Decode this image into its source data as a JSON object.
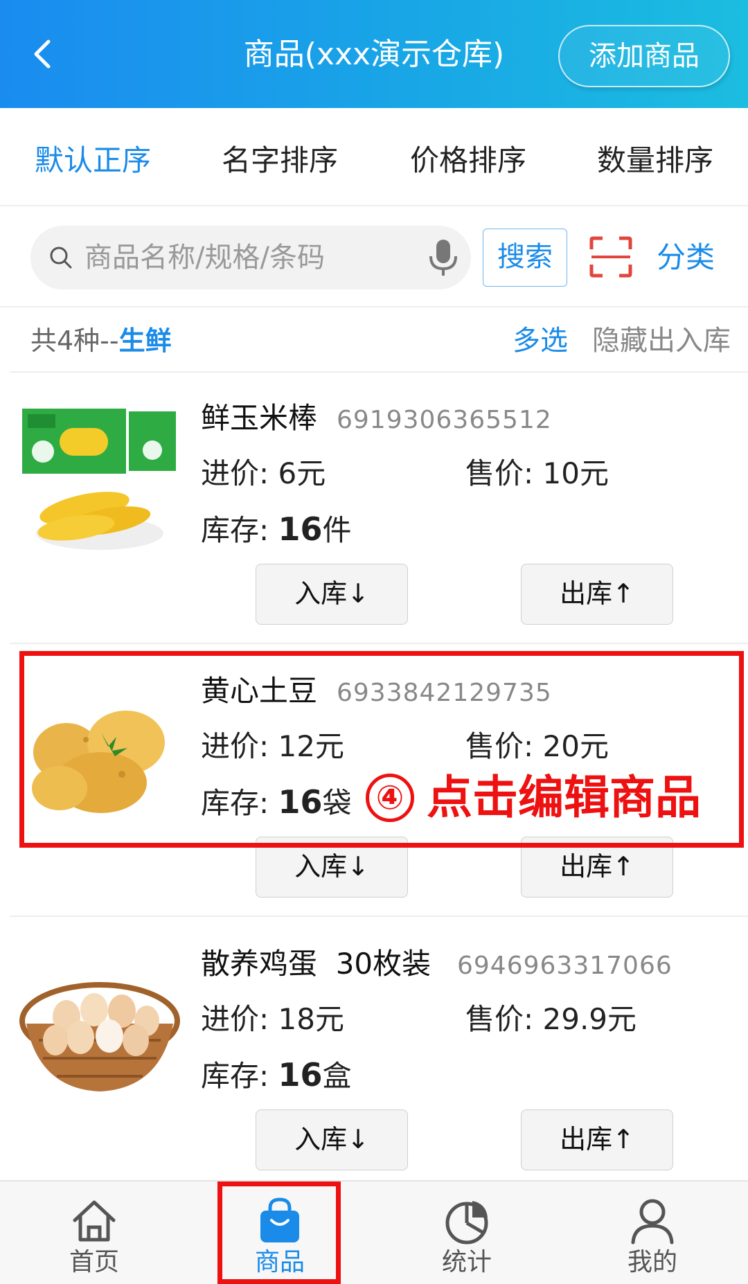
{
  "header": {
    "title": "商品(xxx演示仓库)",
    "add_button": "添加商品"
  },
  "sort_tabs": [
    {
      "label": "默认正序",
      "active": true
    },
    {
      "label": "名字排序",
      "active": false
    },
    {
      "label": "价格排序",
      "active": false
    },
    {
      "label": "数量排序",
      "active": false
    }
  ],
  "search": {
    "placeholder": "商品名称/规格/条码",
    "button": "搜索",
    "category": "分类"
  },
  "summary": {
    "count_text": "共4种--",
    "category": "生鲜",
    "multi_select": "多选",
    "hide_io": "隐藏出入库"
  },
  "products": [
    {
      "name": "鲜玉米棒",
      "code": "6919306365512",
      "cost_label": "进价: ",
      "cost": "6元",
      "price_label": "售价: ",
      "price": "10元",
      "stock_label": "库存: ",
      "stock_qty": "16",
      "stock_unit": "件",
      "in_button": "入库↓",
      "out_button": "出库↑",
      "image": "corn"
    },
    {
      "name": "黄心土豆",
      "code": "6933842129735",
      "cost_label": "进价: ",
      "cost": "12元",
      "price_label": "售价: ",
      "price": "20元",
      "stock_label": "库存: ",
      "stock_qty": "16",
      "stock_unit": "袋",
      "in_button": "入库↓",
      "out_button": "出库↑",
      "image": "potato"
    },
    {
      "name": "散养鸡蛋  30枚装",
      "code": "6946963317066",
      "cost_label": "进价: ",
      "cost": "18元",
      "price_label": "售价: ",
      "price": "29.9元",
      "stock_label": "库存: ",
      "stock_qty": "16",
      "stock_unit": "盒",
      "in_button": "入库↓",
      "out_button": "出库↑",
      "image": "eggs"
    }
  ],
  "annotation": {
    "number": "④",
    "text": "点击编辑商品"
  },
  "nav": [
    {
      "label": "首页",
      "icon": "home-icon",
      "active": false
    },
    {
      "label": "商品",
      "icon": "bag-icon",
      "active": true
    },
    {
      "label": "统计",
      "icon": "pie-chart-icon",
      "active": false
    },
    {
      "label": "我的",
      "icon": "user-icon",
      "active": false
    }
  ],
  "colors": {
    "accent": "#1a8be8",
    "annotation": "#ee1111",
    "header_start": "#1a8cf0",
    "header_end": "#1bbde0"
  }
}
